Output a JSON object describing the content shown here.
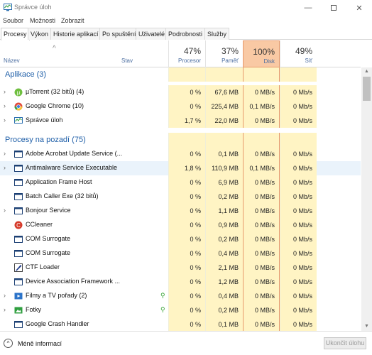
{
  "window": {
    "title": "Správce úloh"
  },
  "menu": [
    "Soubor",
    "Možnosti",
    "Zobrazit"
  ],
  "tabs": [
    "Procesy",
    "Výkon",
    "Historie aplikací",
    "Po spuštění",
    "Uživatelé",
    "Podrobnosti",
    "Služby"
  ],
  "header": {
    "name": "Název",
    "status": "Stav",
    "cpu_pct": "47%",
    "cpu_label": "Procesor",
    "mem_pct": "37%",
    "mem_label": "Paměť",
    "disk_pct": "100%",
    "disk_label": "Disk",
    "net_pct": "49%",
    "net_label": "Síť"
  },
  "groups": {
    "apps": "Aplikace (3)",
    "background": "Procesy na pozadí (75)"
  },
  "apps": [
    {
      "name": "µTorrent (32 bitů) (4)",
      "cpu": "0 %",
      "mem": "67,6 MB",
      "disk": "0 MB/s",
      "net": "0 Mb/s",
      "icon": "utorrent-icon"
    },
    {
      "name": "Google Chrome (10)",
      "cpu": "0 %",
      "mem": "225,4 MB",
      "disk": "0,1 MB/s",
      "net": "0 Mb/s",
      "icon": "chrome-icon"
    },
    {
      "name": "Správce úloh",
      "cpu": "1,7 %",
      "mem": "22,0 MB",
      "disk": "0 MB/s",
      "net": "0 Mb/s",
      "icon": "task-manager-icon"
    }
  ],
  "background": [
    {
      "name": "Adobe Acrobat Update Service (...",
      "cpu": "0 %",
      "mem": "0,1 MB",
      "disk": "0 MB/s",
      "net": "0 Mb/s",
      "icon": "window-icon"
    },
    {
      "name": "Antimalware Service Executable",
      "cpu": "1,8 %",
      "mem": "110,9 MB",
      "disk": "0,1 MB/s",
      "net": "0 Mb/s",
      "icon": "window-icon"
    },
    {
      "name": "Application Frame Host",
      "cpu": "0 %",
      "mem": "6,9 MB",
      "disk": "0 MB/s",
      "net": "0 Mb/s",
      "icon": "window-icon"
    },
    {
      "name": "Batch Caller Exe (32 bitů)",
      "cpu": "0 %",
      "mem": "0,2 MB",
      "disk": "0 MB/s",
      "net": "0 Mb/s",
      "icon": "window-icon"
    },
    {
      "name": "Bonjour Service",
      "cpu": "0 %",
      "mem": "1,1 MB",
      "disk": "0 MB/s",
      "net": "0 Mb/s",
      "icon": "window-icon"
    },
    {
      "name": "CCleaner",
      "cpu": "0 %",
      "mem": "0,9 MB",
      "disk": "0 MB/s",
      "net": "0 Mb/s",
      "icon": "ccleaner-icon"
    },
    {
      "name": "COM Surrogate",
      "cpu": "0 %",
      "mem": "0,2 MB",
      "disk": "0 MB/s",
      "net": "0 Mb/s",
      "icon": "window-icon"
    },
    {
      "name": "COM Surrogate",
      "cpu": "0 %",
      "mem": "0,4 MB",
      "disk": "0 MB/s",
      "net": "0 Mb/s",
      "icon": "window-icon"
    },
    {
      "name": "CTF Loader",
      "cpu": "0 %",
      "mem": "2,1 MB",
      "disk": "0 MB/s",
      "net": "0 Mb/s",
      "icon": "ctf-loader-icon"
    },
    {
      "name": "Device Association Framework ...",
      "cpu": "0 %",
      "mem": "1,2 MB",
      "disk": "0 MB/s",
      "net": "0 Mb/s",
      "icon": "window-icon"
    },
    {
      "name": "Filmy a TV pořady (2)",
      "cpu": "0 %",
      "mem": "0,4 MB",
      "disk": "0 MB/s",
      "net": "0 Mb/s",
      "icon": "films-tv-icon"
    },
    {
      "name": "Fotky",
      "cpu": "0 %",
      "mem": "0,2 MB",
      "disk": "0 MB/s",
      "net": "0 Mb/s",
      "icon": "photos-icon"
    },
    {
      "name": "Google Crash Handler",
      "cpu": "0 %",
      "mem": "0,1 MB",
      "disk": "0 MB/s",
      "net": "0 Mb/s",
      "icon": "window-icon"
    }
  ],
  "footer": {
    "fewer_details": "Méně informací",
    "end_task": "Ukončit úlohu"
  }
}
